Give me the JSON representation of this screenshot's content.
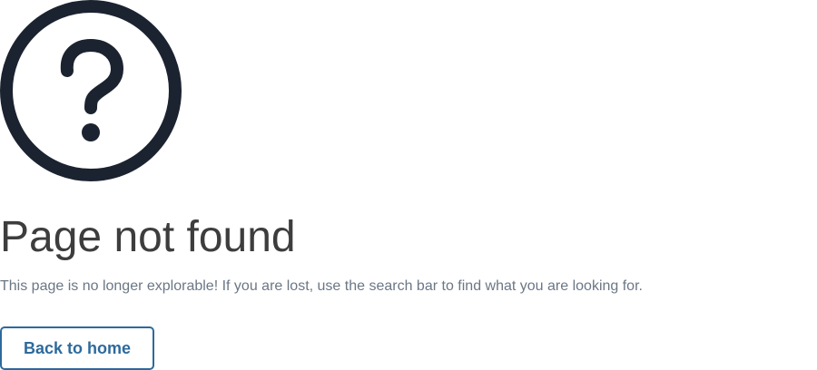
{
  "error_page": {
    "icon": "question-mark-circle-icon",
    "icon_color": "#1b2330",
    "title": "Page not found",
    "description": "This page is no longer explorable! If you are lost, use the search bar to find what you are looking for.",
    "button_label": "Back to home",
    "accent_color": "#2d6a9c"
  }
}
